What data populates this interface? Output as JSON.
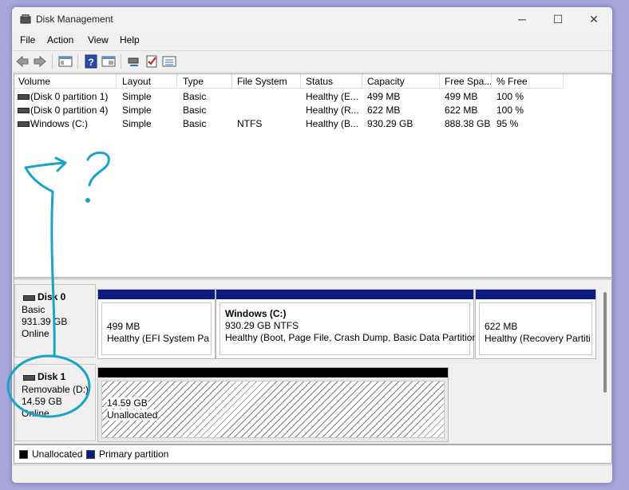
{
  "window": {
    "title": "Disk Management",
    "minimize": "─",
    "maximize": "☐",
    "close": "✕"
  },
  "menu": [
    "File",
    "Action",
    "View",
    "Help"
  ],
  "toolbar_icons": [
    "back-icon",
    "forward-icon",
    "console-tree-icon",
    "help-icon",
    "properties-icon",
    "connect-icon",
    "check-icon",
    "list-icon"
  ],
  "volumes": {
    "columns": [
      "Volume",
      "Layout",
      "Type",
      "File System",
      "Status",
      "Capacity",
      "Free Spa...",
      "% Free"
    ],
    "rows": [
      [
        "(Disk 0 partition 1)",
        "Simple",
        "Basic",
        "",
        "Healthy (E...",
        "499 MB",
        "499 MB",
        "100 %"
      ],
      [
        "(Disk 0 partition 4)",
        "Simple",
        "Basic",
        "",
        "Healthy (R...",
        "622 MB",
        "622 MB",
        "100 %"
      ],
      [
        "Windows (C:)",
        "Simple",
        "Basic",
        "NTFS",
        "Healthy (B...",
        "930.29 GB",
        "888.38 GB",
        "95 %"
      ]
    ]
  },
  "disks": [
    {
      "name": "Disk 0",
      "type": "Basic",
      "size": "931.39 GB",
      "status": "Online",
      "partitions": [
        {
          "title": "",
          "line1": "499 MB",
          "line2": "Healthy (EFI System Parti"
        },
        {
          "title": "Windows  (C:)",
          "line1": "930.29 GB NTFS",
          "line2": "Healthy (Boot, Page File, Crash Dump, Basic Data Partition)"
        },
        {
          "title": "",
          "line1": "622 MB",
          "line2": "Healthy (Recovery Partitio"
        }
      ]
    },
    {
      "name": "Disk 1",
      "type": "Removable (D:)",
      "size": "14.59 GB",
      "status": "Online",
      "partitions": [
        {
          "line1": "14.59 GB",
          "line2": "Unallocated"
        }
      ]
    }
  ],
  "legend": [
    {
      "label": "Unallocated",
      "color": "#000000"
    },
    {
      "label": "Primary partition",
      "color": "#0a1a80"
    }
  ],
  "annotation": {
    "text": "?",
    "color": "#1aa3c4"
  }
}
